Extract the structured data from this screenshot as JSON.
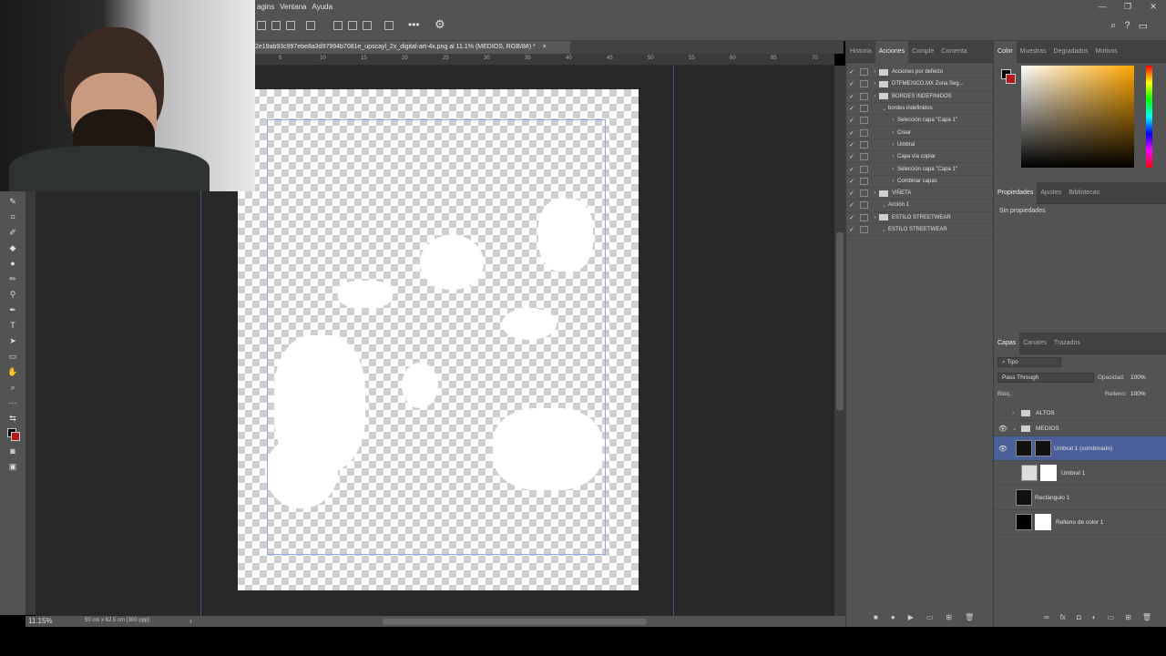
{
  "menubar": {
    "items": [
      "agins",
      "Ventana",
      "Ayuda"
    ]
  },
  "window_controls": [
    "—",
    "❐",
    "✕"
  ],
  "document": {
    "tab_title": "2e19ab93c997ebe8a3d97994b7081e_upscayl_2x_digital-art-4x.png al 11.1% (MEDIOS, RGB/8#) *",
    "close": "×"
  },
  "ruler_ticks": [
    "5",
    "10",
    "15",
    "20",
    "25",
    "30",
    "35",
    "40",
    "45",
    "50",
    "55",
    "60",
    "65",
    "70"
  ],
  "status": {
    "zoom": "11.15%",
    "doc_size": "50 cm x 62.5 cm (300 ppp)"
  },
  "mid_panel": {
    "tabs": [
      "Historia",
      "Acciones",
      "Comple",
      "Comenta"
    ],
    "active_tab": "Acciones",
    "actions": [
      {
        "label": "Acciones por defecto",
        "indent": 0,
        "type": "set"
      },
      {
        "label": "DTFMEXICO.MX Zona Seg...",
        "indent": 0,
        "type": "set"
      },
      {
        "label": "BORDES INDEFINIDOS",
        "indent": 0,
        "type": "set"
      },
      {
        "label": "bordes indefinidos",
        "indent": 1,
        "type": "action"
      },
      {
        "label": "Selección capa \"Capa 1\"",
        "indent": 2,
        "type": "step"
      },
      {
        "label": "Crear",
        "indent": 2,
        "type": "step"
      },
      {
        "label": "Umbral",
        "indent": 2,
        "type": "step"
      },
      {
        "label": "Capa vía copiar",
        "indent": 2,
        "type": "step"
      },
      {
        "label": "Selección capa \"Capa 1\"",
        "indent": 2,
        "type": "step"
      },
      {
        "label": "Combinar capas",
        "indent": 2,
        "type": "step"
      },
      {
        "label": "VIÑETA",
        "indent": 0,
        "type": "set"
      },
      {
        "label": "Acción 1",
        "indent": 1,
        "type": "action"
      },
      {
        "label": "ESTILO STREETWEAR",
        "indent": 0,
        "type": "set"
      },
      {
        "label": "ESTILO STREETWEAR",
        "indent": 1,
        "type": "action"
      }
    ]
  },
  "right_panel": {
    "color_tabs": [
      "Color",
      "Muestras",
      "Degradados",
      "Motivos"
    ],
    "props_tabs": [
      "Propiedades",
      "Ajustes",
      "Bibliotecas"
    ],
    "props_text": "Sin propiedades",
    "layers_tabs": [
      "Capas",
      "Canales",
      "Trazados"
    ],
    "filter": "Tipo",
    "blend_mode": "Pass Through",
    "opacity_label": "Opacidad:",
    "opacity": "100%",
    "lock_label": "Bloq.:",
    "fill_label": "Relleno:",
    "fill": "100%",
    "layers": [
      {
        "name": "ALTOS",
        "kind": "group",
        "visible": false
      },
      {
        "name": "MEDIOS",
        "kind": "group",
        "visible": true
      },
      {
        "name": "Umbral 1 (combinado)",
        "kind": "layer",
        "visible": true,
        "selected": true
      },
      {
        "name": "Umbral 1",
        "kind": "adjust",
        "visible": false
      },
      {
        "name": "Rectángulo 1",
        "kind": "layer",
        "visible": false
      },
      {
        "name": "Relleno de color 1",
        "kind": "fill",
        "visible": false
      }
    ]
  },
  "colors": {
    "ui_bg": "#535353",
    "canvas_bg": "#282828",
    "accent_selected": "#4b5f9b",
    "guide": "#93a8e6"
  }
}
